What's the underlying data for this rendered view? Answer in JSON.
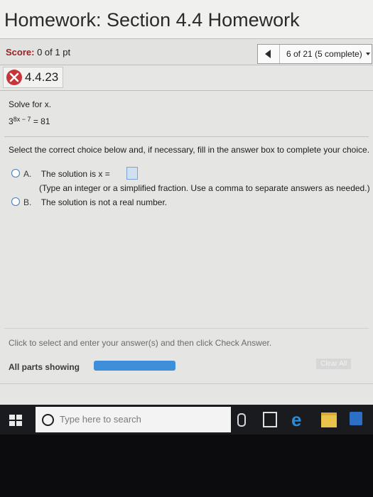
{
  "header": {
    "title": "Homework: Section 4.4 Homework",
    "score_label": "Score:",
    "score_value": "0 of 1 pt",
    "nav_text": "6 of 21 (5 complete)"
  },
  "question": {
    "id": "4.4.23",
    "prompt": "Solve for x.",
    "equation": {
      "base": "3",
      "exponent": "8x − 7",
      "rhs": "= 81"
    },
    "instruction": "Select the correct choice below and, if necessary, fill in the answer box to complete your choice.",
    "choices": [
      {
        "letter": "A.",
        "text": "The solution is x =",
        "hint": "(Type an integer or a simplified fraction. Use a comma to separate answers as needed.)"
      },
      {
        "letter": "B.",
        "text": "The solution is not a real number."
      }
    ]
  },
  "footer": {
    "instructions": "Click to select and enter your answer(s) and then click Check Answer.",
    "parts_label": "All parts showing",
    "clear_all": "Clear All"
  },
  "taskbar": {
    "search_placeholder": "Type here to search"
  },
  "colors": {
    "score_label": "#9b2121",
    "incorrect_mark": "#c9343a",
    "radio_border": "#4a7bb5",
    "progress_fill": "#3c8fd8",
    "taskbar_bg": "#1a1b1f"
  },
  "icons": {
    "nav_prev": "left-triangle-icon",
    "incorrect": "x-circle-icon",
    "start": "windows-logo-icon",
    "search": "circle-search-icon",
    "mic": "microphone-icon",
    "task_view": "task-view-icon",
    "browser": "edge-icon",
    "explorer": "folder-icon",
    "store": "store-icon"
  }
}
